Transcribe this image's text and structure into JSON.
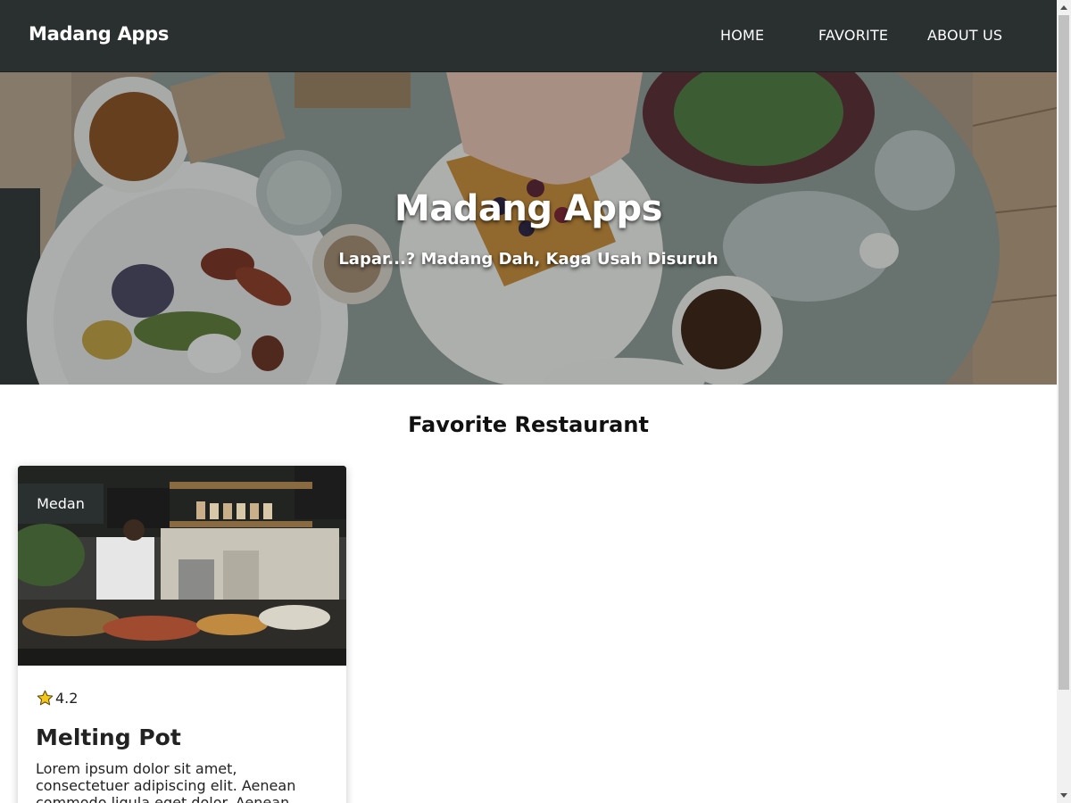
{
  "navbar": {
    "brand": "Madang Apps",
    "links": [
      {
        "label": "HOME"
      },
      {
        "label": "FAVORITE"
      },
      {
        "label": "ABOUT US"
      }
    ],
    "background": "#2a3030"
  },
  "hero": {
    "title": "Madang Apps",
    "subtitle": "Lapar...? Madang Dah, Kaga Usah Disuruh"
  },
  "section": {
    "title": "Favorite Restaurant"
  },
  "restaurants": [
    {
      "city": "Medan",
      "rating": "4.2",
      "name": "Melting Pot",
      "description": "Lorem ipsum dolor sit amet, consectetuer adipiscing elit. Aenean commodo ligula eget dolor. Aenean"
    }
  ],
  "icons": {
    "rating": "star-icon",
    "scroll_up": "chevron-up-icon",
    "scroll_down": "chevron-down-icon"
  },
  "colors": {
    "accent_dark": "#2a3030",
    "star": "#f5c518"
  }
}
